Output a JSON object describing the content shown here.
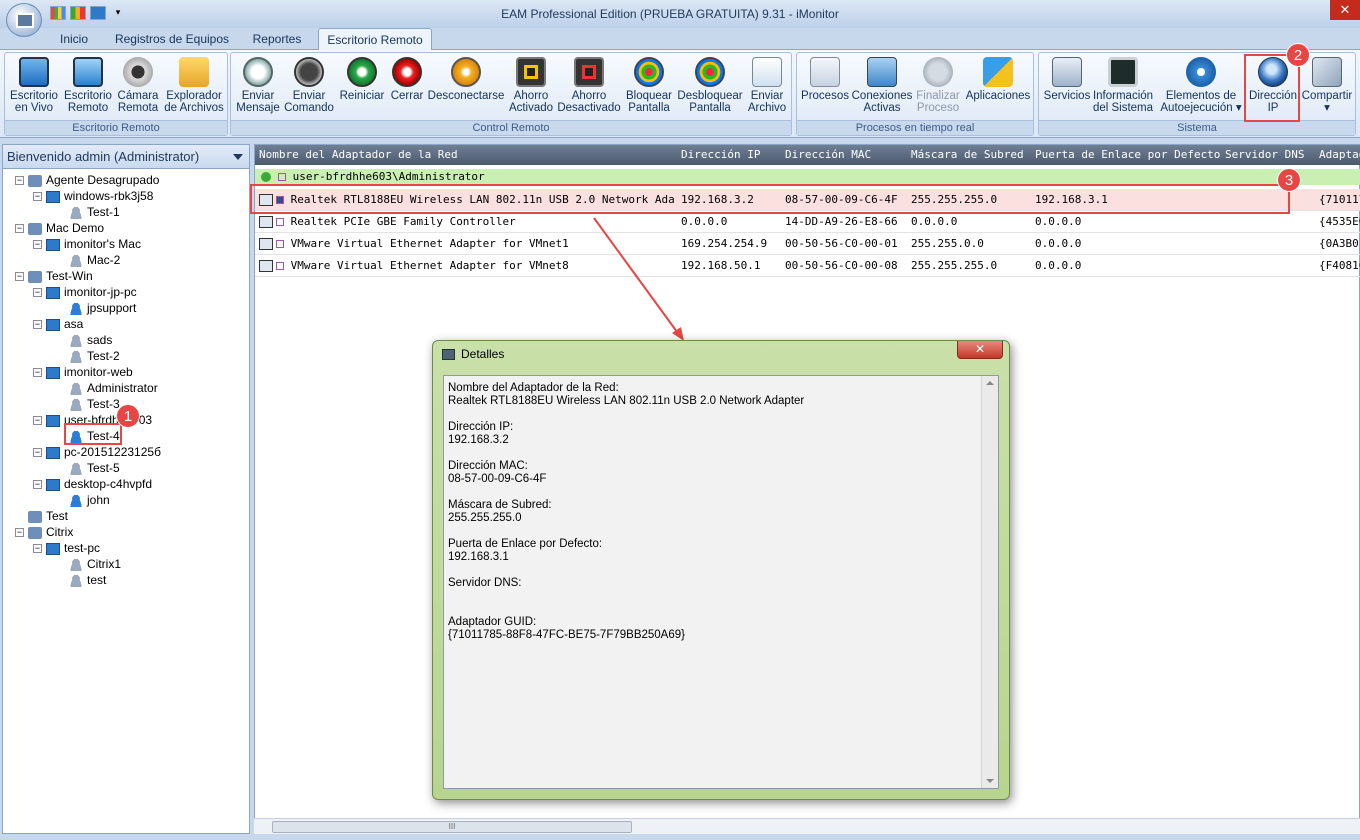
{
  "window": {
    "title": "EAM Professional Edition (PRUEBA GRATUITA) 9.31 - iMonitor",
    "close": "✕"
  },
  "tabs": [
    "Inicio",
    "Registros de Equipos",
    "Reportes",
    "Escritorio Remoto"
  ],
  "ribbon": {
    "groups": [
      "Escritorio Remoto",
      "Control Remoto",
      "Procesos en tiempo real",
      "Sistema"
    ],
    "buttons": {
      "b0": {
        "l1": "Escritorio",
        "l2": "en Vivo"
      },
      "b1": {
        "l1": "Escritorio",
        "l2": "Remoto"
      },
      "b2": {
        "l1": "Cámara",
        "l2": "Remota"
      },
      "b3": {
        "l1": "Explorador",
        "l2": "de Archivos"
      },
      "b4": {
        "l1": "Enviar",
        "l2": "Mensaje"
      },
      "b5": {
        "l1": "Enviar",
        "l2": "Comando"
      },
      "b6": {
        "l1": "Reiniciar",
        "l2": ""
      },
      "b7": {
        "l1": "Cerrar",
        "l2": ""
      },
      "b8": {
        "l1": "Desconectarse",
        "l2": ""
      },
      "b9": {
        "l1": "Ahorro",
        "l2": "Activado"
      },
      "b10": {
        "l1": "Ahorro",
        "l2": "Desactivado"
      },
      "b11": {
        "l1": "Bloquear",
        "l2": "Pantalla"
      },
      "b12": {
        "l1": "Desbloquear",
        "l2": "Pantalla"
      },
      "b13": {
        "l1": "Enviar",
        "l2": "Archivo"
      },
      "b14": {
        "l1": "Procesos",
        "l2": ""
      },
      "b15": {
        "l1": "Conexiones",
        "l2": "Activas"
      },
      "b16": {
        "l1": "Finalizar",
        "l2": "Proceso"
      },
      "b17": {
        "l1": "Aplicaciones",
        "l2": ""
      },
      "b18": {
        "l1": "Servicios",
        "l2": ""
      },
      "b19": {
        "l1": "Información",
        "l2": "del Sistema"
      },
      "b20": {
        "l1": "Elementos de",
        "l2": "Autoejecución ▾"
      },
      "b21": {
        "l1": "Dirección",
        "l2": "IP"
      },
      "b22": {
        "l1": "Compartir",
        "l2": "▾"
      }
    }
  },
  "badges": [
    "1",
    "2",
    "3"
  ],
  "left_panel": {
    "header": "Bienvenido admin (Administrator)",
    "tree": [
      {
        "label": "Agente Desagrupado"
      },
      {
        "label": "windows-rbk3j58"
      },
      {
        "label": "Test-1"
      },
      {
        "label": "Mac Demo"
      },
      {
        "label": "imonitor's Mac"
      },
      {
        "label": "Mac-2"
      },
      {
        "label": "Test-Win"
      },
      {
        "label": "imonitor-jp-pc"
      },
      {
        "label": "jpsupport"
      },
      {
        "label": "asa"
      },
      {
        "label": "sads"
      },
      {
        "label": "Test-2"
      },
      {
        "label": "imonitor-web"
      },
      {
        "label": "Administrator"
      },
      {
        "label": "Test-3"
      },
      {
        "label": "user-bfrdhhe603"
      },
      {
        "label": "Test-4"
      },
      {
        "label": "pc-20151223125б"
      },
      {
        "label": "Test-5"
      },
      {
        "label": "desktop-c4hvpfd"
      },
      {
        "label": "john"
      },
      {
        "label": "Test"
      },
      {
        "label": "Citrix"
      },
      {
        "label": "test-pc"
      },
      {
        "label": "Citrix1"
      },
      {
        "label": "test"
      }
    ]
  },
  "table": {
    "columns": [
      "Nombre del Adaptador de la Red",
      "Dirección IP",
      "Dirección MAC",
      "Máscara de Subred",
      "Puerta de Enlace por Defecto",
      "Servidor DNS",
      "Adaptad"
    ],
    "group": "user-bfrdhhe603\\Administrator",
    "rows": [
      {
        "name": "Realtek RTL8188EU Wireless LAN 802.11n USB 2.0 Network Adapter",
        "ip": "192.168.3.2",
        "mac": "08-57-00-09-C6-4F",
        "mask": "255.255.255.0",
        "gw": "192.168.3.1",
        "dns": "",
        "guid": "{710117"
      },
      {
        "name": "Realtek PCIe GBE Family Controller",
        "ip": "0.0.0.0",
        "mac": "14-DD-A9-26-E8-66",
        "mask": "0.0.0.0",
        "gw": "0.0.0.0",
        "dns": "",
        "guid": "{4535E0"
      },
      {
        "name": "VMware Virtual Ethernet Adapter for VMnet1",
        "ip": "169.254.254.9",
        "mac": "00-50-56-C0-00-01",
        "mask": "255.255.0.0",
        "gw": "0.0.0.0",
        "dns": "",
        "guid": "{0A3B01"
      },
      {
        "name": "VMware Virtual Ethernet Adapter for VMnet8",
        "ip": "192.168.50.1",
        "mac": "00-50-56-C0-00-08",
        "mask": "255.255.255.0",
        "gw": "0.0.0.0",
        "dns": "",
        "guid": "{F4081C"
      }
    ]
  },
  "dialog": {
    "title": "Detalles",
    "close": "✕",
    "lines": {
      "l0": "Nombre del Adaptador de la Red:",
      "l1": "Realtek RTL8188EU Wireless LAN 802.11n USB 2.0 Network Adapter",
      "l2": "Dirección IP:",
      "l3": "192.168.3.2",
      "l4": "Dirección MAC:",
      "l5": "08-57-00-09-C6-4F",
      "l6": "Máscara de Subred:",
      "l7": "255.255.255.0",
      "l8": "Puerta de Enlace por Defecto:",
      "l9": "192.168.3.1",
      "l10": "Servidor DNS:",
      "l11": "Adaptador GUID:",
      "l12": "{71011785-88F8-47FC-BE75-7F79BB250A69}"
    }
  },
  "scroll_thumb": "III"
}
